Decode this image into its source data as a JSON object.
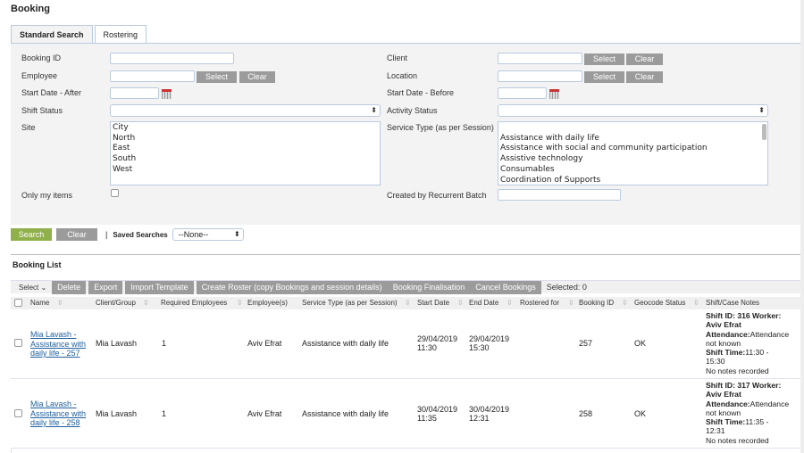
{
  "page_title": "Booking",
  "tabs": [
    {
      "label": "Standard Search",
      "active": true
    },
    {
      "label": "Rostering",
      "active": false
    }
  ],
  "form": {
    "booking_id": {
      "label": "Booking ID",
      "value": ""
    },
    "employee": {
      "label": "Employee",
      "value": "",
      "select": "Select",
      "clear": "Clear"
    },
    "start_after": {
      "label": "Start Date - After",
      "value": ""
    },
    "shift_status": {
      "label": "Shift Status",
      "value": ""
    },
    "site": {
      "label": "Site",
      "options": [
        "City",
        "North",
        "East",
        "South",
        "West"
      ]
    },
    "only_mine": {
      "label": "Only my items",
      "checked": false
    },
    "client": {
      "label": "Client",
      "value": "",
      "select": "Select",
      "clear": "Clear"
    },
    "location": {
      "label": "Location",
      "value": "",
      "select": "Select",
      "clear": "Clear"
    },
    "start_before": {
      "label": "Start Date - Before",
      "value": ""
    },
    "activity_status": {
      "label": "Activity Status",
      "value": ""
    },
    "service_type": {
      "label": "Service Type (as per Session)",
      "options": [
        "",
        "Assistance with daily life",
        "Assistance with social and community participation",
        "Assistive technology",
        "Consumables",
        "Coordination of Supports"
      ]
    },
    "recurrent_batch": {
      "label": "Created by Recurrent Batch",
      "value": ""
    }
  },
  "search_bar": {
    "search": "Search",
    "clear": "Clear",
    "separator": "|",
    "saved_label": "Saved Searches",
    "saved_value": "--None--"
  },
  "list": {
    "title": "Booking List",
    "select_label": "Select",
    "actions": [
      "Delete",
      "Export",
      "Import Template",
      "Create Roster (copy Bookings and session details)",
      "Booking Finalisation",
      "Cancel Bookings"
    ],
    "selected": "Selected: 0",
    "columns": [
      "Name",
      "Client/Group",
      "Required Employees",
      "Employee(s)",
      "Service Type (as per Session)",
      "Start Date",
      "End Date",
      "Rostered for",
      "Booking ID",
      "Geocode Status",
      "Shift/Case Notes"
    ],
    "rows": [
      {
        "name_l1": "Mia Lavash -",
        "name_l2": "Assistance with",
        "name_l3": "daily life - 257",
        "client": "Mia Lavash",
        "req": "1",
        "employee": "Aviv Efrat",
        "service": "Assistance with daily life",
        "start1": "29/04/2019",
        "start2": "11:30",
        "end1": "29/04/2019",
        "end2": "15:30",
        "rostered": "",
        "booking_id": "257",
        "geocode": "OK",
        "notes": {
          "shift_label": "Shift ID: 316 Worker:",
          "worker": "Aviv Efrat",
          "att_label": "Attendance:",
          "att_val": "Attendance",
          "att_val2": "not known",
          "time_label": "Shift Time:",
          "time_val": "11:30 -",
          "time_val2": "15:30",
          "note": "No notes recorded"
        }
      },
      {
        "name_l1": "Mia Lavash -",
        "name_l2": "Assistance with",
        "name_l3": "daily life - 258",
        "client": "Mia Lavash",
        "req": "1",
        "employee": "Aviv Efrat",
        "service": "Assistance with daily life",
        "start1": "30/04/2019",
        "start2": "11:35",
        "end1": "30/04/2019",
        "end2": "12:31",
        "rostered": "",
        "booking_id": "258",
        "geocode": "OK",
        "notes": {
          "shift_label": "Shift ID: 317 Worker:",
          "worker": "Aviv Efrat",
          "att_label": "Attendance:",
          "att_val": "Attendance",
          "att_val2": "not known",
          "time_label": "Shift Time:",
          "time_val": "11:35 -",
          "time_val2": "12:31",
          "note": "No notes recorded"
        }
      }
    ]
  },
  "icons": {
    "calendar": "calendar-icon",
    "sort": "sort-icon",
    "select_arrow": "updown-arrow-icon"
  },
  "colors": {
    "search_btn": "#8fb04a",
    "grey_btn": "#9b9b9b",
    "link": "#1f5fa0",
    "panel": "#f3f3f3"
  }
}
